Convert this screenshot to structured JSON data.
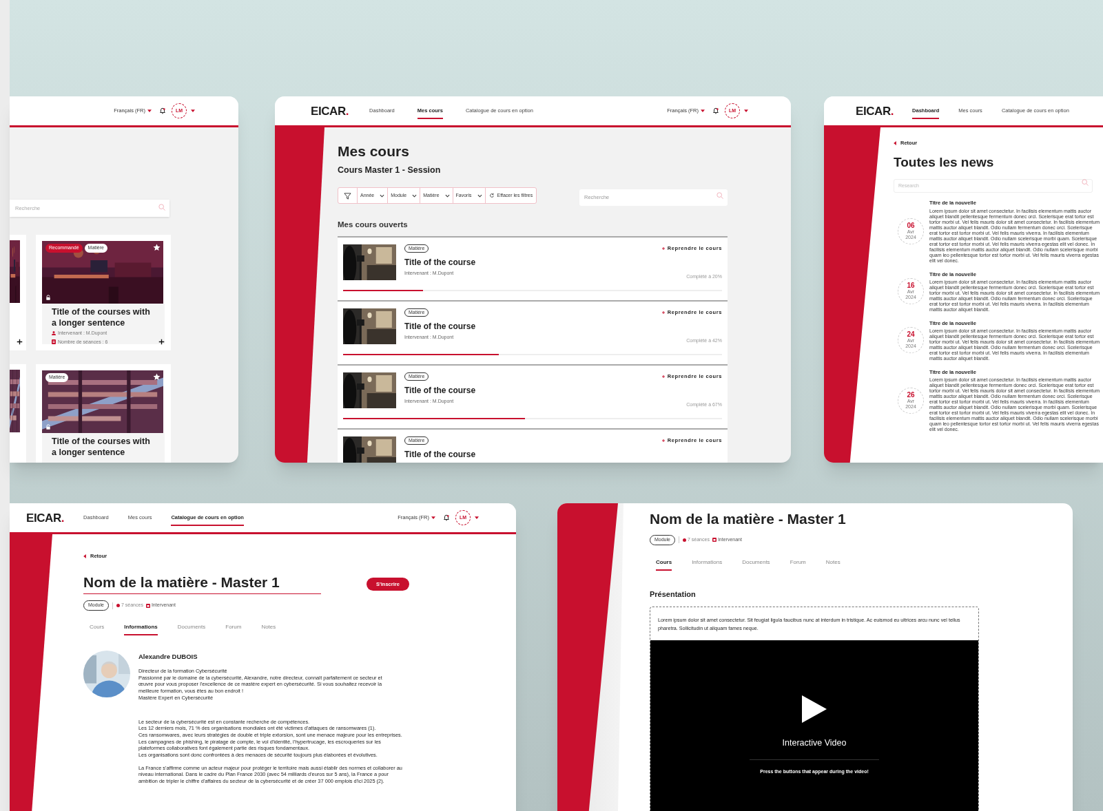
{
  "catalog_screen": {
    "header": {
      "language": "Français (FR)",
      "avatar": "LM"
    },
    "search": {
      "placeholder": "Recherche"
    },
    "cards": [
      {
        "badges": [
          {
            "kind": "recommended",
            "label": "Recommandé"
          },
          {
            "kind": "subject",
            "label": "Matière"
          }
        ],
        "title": "Title of the courses with a longer sentence",
        "meta": [
          {
            "kind": "instructor",
            "text": "Intervenant : M.Dupont"
          },
          {
            "kind": "sessions",
            "text": "Nombre de séances : 6"
          }
        ]
      },
      {
        "badges": [
          {
            "kind": "subject",
            "label": "Matière"
          }
        ],
        "title": "Title of the courses with a longer sentence"
      }
    ]
  },
  "courses_screen": {
    "header": {
      "logo": "EICAR",
      "logo_dot": ".",
      "nav": [
        {
          "label": "Dashboard",
          "selected": false
        },
        {
          "label": "Mes cours",
          "selected": true
        },
        {
          "label": "Catalogue de cours en option",
          "selected": false
        }
      ],
      "language": "Français (FR)",
      "avatar": "LM"
    },
    "title": "Mes cours",
    "subtitle": "Cours Master 1 - Session",
    "filters": [
      "Année",
      "Module",
      "Matière",
      "Favoris"
    ],
    "clear_filters": "Effacer les filtres",
    "search": {
      "placeholder": "Recherche"
    },
    "section_title": "Mes cours ouverts",
    "courses": [
      {
        "badge": "Matière",
        "title": "Title of the course",
        "instructor": "Intervenant : M.Dupont",
        "action": "Reprendre le cours",
        "progress_label": "Complété à 20%",
        "level": 0.21
      },
      {
        "badge": "Matière",
        "title": "Title of the course",
        "instructor": "Intervenant : M.Dupont",
        "action": "Reprendre le cours",
        "progress_label": "Complété à 42%",
        "level": 0.41
      },
      {
        "badge": "Matière",
        "title": "Title of the course",
        "instructor": "Intervenant : M.Dupont",
        "action": "Reprendre le cours",
        "progress_label": "Complété à 67%",
        "level": 0.48
      },
      {
        "badge": "Matière",
        "title": "Title of the course",
        "action": "Reprendre le cours"
      }
    ]
  },
  "news_screen": {
    "header": {
      "logo": "EICAR",
      "logo_dot": ".",
      "nav": [
        {
          "label": "Dashboard",
          "selected": true
        },
        {
          "label": "Mes cours",
          "selected": false
        },
        {
          "label": "Catalogue de cours en option",
          "selected": false
        }
      ]
    },
    "back": "Retour",
    "title": "Toutes les news",
    "search": {
      "placeholder": "Research"
    },
    "news": [
      {
        "day": "06",
        "month": "Avr",
        "year": "2024",
        "title": "Titre de la nouvelle",
        "body": "Lorem ipsum dolor sit amet consectetur. In facilisis elementum mattis auctor aliquet blandit pellentesque fermentum donec orci. Scelerisque erat tortor est tortor morbi ut. Vel felis mauris dolor sit amet consectetur. In facilisis elementum mattis auctor aliquet blandit. Odio nullam fermentum donec orci. Scelerisque erat tortor est tortor morbi ut. Vel felis mauris viverra. In facilisis elementum mattis auctor aliquet blandit. Odio nullam scelerisque morbi quam. Scelerisque erat tortor est tortor morbi ut. Vel felis mauris viverra egestas elit vel donec. In facilisis elementum mattis auctor aliquet blandit. Odio nullam scelerisque morbi quam leo pellentesque tortor est tortor morbi ut. Vel felis mauris viverra egestas elit vel donec."
      },
      {
        "day": "16",
        "month": "Avr",
        "year": "2024",
        "title": "Titre de la nouvelle",
        "body": "Lorem ipsum dolor sit amet consectetur. In facilisis elementum mattis auctor aliquet blandit pellentesque fermentum donec orci. Scelerisque erat tortor est tortor morbi ut. Vel felis mauris dolor sit amet consectetur. In facilisis elementum mattis auctor aliquet blandit. Odio nullam fermentum donec orci. Scelerisque erat tortor est tortor morbi ut. Vel felis mauris viverra. In facilisis elementum mattis auctor aliquet blandit."
      },
      {
        "day": "24",
        "month": "Avr",
        "year": "2024",
        "title": "Titre de la nouvelle",
        "body": "Lorem ipsum dolor sit amet consectetur. In facilisis elementum mattis auctor aliquet blandit pellentesque fermentum donec orci. Scelerisque erat tortor est tortor morbi ut. Vel felis mauris dolor sit amet consectetur. In facilisis elementum mattis auctor aliquet blandit. Odio nullam fermentum donec orci. Scelerisque erat tortor est tortor morbi ut. Vel felis mauris viverra. In facilisis elementum mattis auctor aliquet blandit."
      },
      {
        "day": "26",
        "month": "Avr",
        "year": "2024",
        "title": "Titre de la nouvelle",
        "body": "Lorem ipsum dolor sit amet consectetur. In facilisis elementum mattis auctor aliquet blandit pellentesque fermentum donec orci. Scelerisque erat tortor est tortor morbi ut. Vel felis mauris dolor sit amet consectetur. In facilisis elementum mattis auctor aliquet blandit. Odio nullam fermentum donec orci. Scelerisque erat tortor est tortor morbi ut. Vel felis mauris viverra. In facilisis elementum mattis auctor aliquet blandit. Odio nullam scelerisque morbi quam. Scelerisque erat tortor est tortor morbi ut. Vel felis mauris viverra egestas elit vel donec. In facilisis elementum mattis auctor aliquet blandit. Odio nullam scelerisque morbi quam leo pellentesque tortor est tortor morbi ut. Vel felis mauris viverra egestas elit vel donec."
      }
    ]
  },
  "subject_info_screen": {
    "header": {
      "logo": "EICAR",
      "logo_dot": ".",
      "nav": [
        {
          "label": "Dashboard",
          "selected": false
        },
        {
          "label": "Mes cours",
          "selected": false
        },
        {
          "label": "Catalogue de cours en option",
          "selected": true
        }
      ],
      "language": "Français (FR)",
      "avatar": "LM"
    },
    "back": "Retour",
    "title": "Nom de la matière - Master 1",
    "enroll_button": "S'inscrire",
    "tag": "Module",
    "sessions": "7 séances",
    "instructor": "Intervenant",
    "tabs": [
      {
        "label": "Cours",
        "selected": false
      },
      {
        "label": "Informations",
        "selected": true
      },
      {
        "label": "Documents",
        "selected": false
      },
      {
        "label": "Forum",
        "selected": false
      },
      {
        "label": "Notes",
        "selected": false
      }
    ],
    "person": {
      "name": "Alexandre DUBOIS",
      "bio": "Directeur de la formation Cybersécurité\nPassionné par le domaine de la cybersécurité, Alexandre, notre directeur, connaît parfaitement ce secteur et œuvre pour vous proposer l'excellence de ce mastère expert en cybersécurité. Si vous souhaitez recevoir la meilleure formation, vous êtes au bon endroit !\nMastère Expert en Cybersécurité"
    },
    "paragraphs": [
      "Le secteur de la cybersécurité est en constante recherche de compétences.\nLes 12 derniers mois, 71 % des organisations mondiales ont été victimes d'attaques de ransomwares (1).\nCes ransomwares, avec leurs stratégies de double et triple extorsion, sont une menace majeure pour les entreprises. Les campagnes de phishing, le piratage de compte, le vol d'identité, l'hypertrucage, les escroqueries sur les plateformes collaboratives font également partie des risques fondamentaux.\nLes organisations sont donc confrontées à des menaces de sécurité toujours plus élaborées et évolutives.",
      "La France s'affirme comme un acteur majeur pour protéger le territoire mais aussi établir des normes et collaborer au niveau international. Dans le cadre du Plan France 2030 (avec 54 milliards d'euros sur 5 ans), la France a pour ambition de tripler le chiffre d'affaires du secteur de la cybersécurité et de créer 37 000 emplois d'ici 2025 (2)."
    ]
  },
  "subject_course_screen": {
    "title": "Nom de la matière - Master 1",
    "tag": "Module",
    "sessions": "7 séances",
    "instructor": "Intervenant",
    "tabs": [
      {
        "label": "Cours",
        "selected": true
      },
      {
        "label": "Informations",
        "selected": false
      },
      {
        "label": "Documents",
        "selected": false
      },
      {
        "label": "Forum",
        "selected": false
      },
      {
        "label": "Notes",
        "selected": false
      }
    ],
    "section_title": "Présentation",
    "description": "Lorem ipsum dolor sit amet consectetur. Sit feugiat ligula faucibus nunc at interdum in tristique. Ac euismod eu ultrices arcu nunc vel tellus pharetra. Sollicitudin ut aliquam fames neque.",
    "video": {
      "title": "Interactive Video",
      "hint": "Press the buttons that appear during the video!"
    }
  }
}
